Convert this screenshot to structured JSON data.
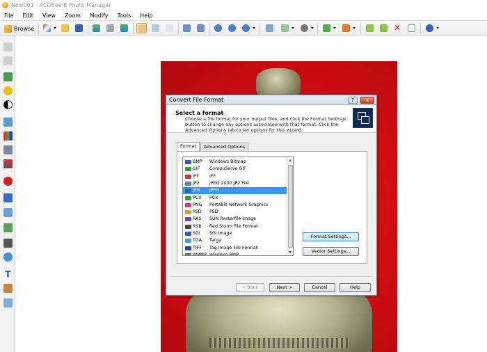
{
  "window": {
    "title": "New001 - ACDSee 8 Photo Manager"
  },
  "menu": [
    "File",
    "Edit",
    "View",
    "Zoom",
    "Modify",
    "Tools",
    "Help"
  ],
  "toolbar": {
    "browse_label": "Browse",
    "icons": [
      "batch-edit-icon",
      "open-folder-icon",
      "save-icon",
      "save-as-icon",
      "scan-icon",
      "acquire-icon",
      "hand-tool-icon",
      "zoom-fit-icon",
      "rotate-left-icon",
      "rotate-right-icon",
      "zoom-in-icon",
      "zoom-out-icon",
      "zoom-menu-icon",
      "rotate-menu-icon",
      "lens-icon",
      "slideshow-icon",
      "wallpaper-icon",
      "previous-image-icon",
      "next-image-icon",
      "delete-icon",
      "properties-icon",
      "help-icon"
    ]
  },
  "sidebar_tools": [
    "undo-icon",
    "redo-icon",
    "red-eye-icon",
    "exposure-icon",
    "contrast-icon",
    "image-icon",
    "levels-icon",
    "color-icon",
    "tone-curves-icon",
    "red-eye-reduction-icon",
    "sharpen-icon",
    "frame-icon",
    "effects-icon",
    "crop-icon",
    "rotate-icon",
    "text-icon",
    "repair-icon",
    "filter-icon"
  ],
  "dialog": {
    "title": "Convert File Format",
    "help_button": "?",
    "close_button": "x",
    "heading": "Select a format",
    "description": "Choose a file format for your output files, and click the Format Settings button to change any options associated with that format. Click the Advanced Options tab to set options for this wizard.",
    "tabs": [
      "Format",
      "Advanced Options"
    ],
    "formats": [
      {
        "ext": "BMP",
        "desc": "Windows Bitmap",
        "color": "#2b5fc9"
      },
      {
        "ext": "GIF",
        "desc": "CompuServe GIF",
        "color": "#3a9a3a"
      },
      {
        "ext": "IFF",
        "desc": "IFF",
        "color": "#c23b3b"
      },
      {
        "ext": "JP2",
        "desc": "JPEG 2000 JP2 File",
        "color": "#5a7fb0"
      },
      {
        "ext": "JPG",
        "desc": "JPEG",
        "color": "#2b5fc9"
      },
      {
        "ext": "PCX",
        "desc": "PCX",
        "color": "#3a9a3a"
      },
      {
        "ext": "PNG",
        "desc": "Portable Network Graphics",
        "color": "#cc3d8c"
      },
      {
        "ext": "PSD",
        "desc": "PSD",
        "color": "#e0a020"
      },
      {
        "ext": "RAS",
        "desc": "SUN Rasterfile Image",
        "color": "#7a3fb0"
      },
      {
        "ext": "RSB",
        "desc": "Red Storm File Format",
        "color": "#444444"
      },
      {
        "ext": "SGI",
        "desc": "SGI Image",
        "color": "#3a5ad0"
      },
      {
        "ext": "TGA",
        "desc": "Targa",
        "color": "#4aa0c0"
      },
      {
        "ext": "TIFF",
        "desc": "Tag Image File Format",
        "color": "#2b3fa0"
      },
      {
        "ext": "WBMP",
        "desc": "Wireless BMP",
        "color": "#6a6a6a"
      }
    ],
    "selected_format": "JPG",
    "format_settings_label": "Format Settings...",
    "vector_settings_label": "Vector Settings...",
    "back_label": "< Back",
    "next_label": "Next >",
    "cancel_label": "Cancel",
    "help_label": "Help"
  },
  "colors": {
    "selection": "#3399ff",
    "active_tool": "#ffd9a4",
    "photo_background": "#d3101a"
  }
}
